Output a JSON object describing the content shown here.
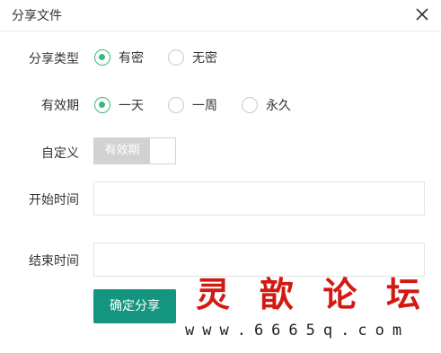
{
  "dialog": {
    "title": "分享文件",
    "close_icon": "close-icon"
  },
  "share_type": {
    "label": "分享类型",
    "options": [
      "有密",
      "无密"
    ],
    "selected": "有密"
  },
  "validity": {
    "label": "有效期",
    "options": [
      "一天",
      "一周",
      "永久"
    ],
    "selected": "一天"
  },
  "custom": {
    "label": "自定义",
    "switch_label": "有效期",
    "enabled": false
  },
  "start_time": {
    "label": "开始时间",
    "value": ""
  },
  "end_time": {
    "label": "结束时间",
    "value": ""
  },
  "submit": {
    "label": "确定分享"
  },
  "watermark": {
    "chars": [
      "灵",
      "歆",
      "论",
      "坛"
    ],
    "url": "www.6665q.com"
  },
  "colors": {
    "accent_green": "#3fb67f",
    "button_teal": "#14957f",
    "watermark_red": "#d21a12"
  }
}
